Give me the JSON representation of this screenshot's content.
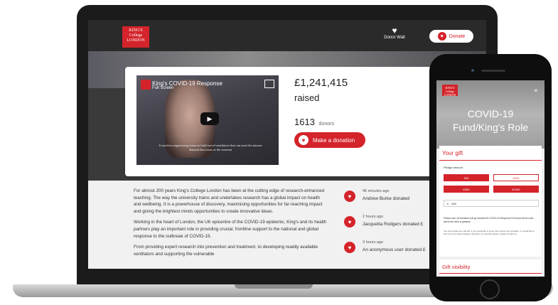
{
  "header": {
    "logo_text": "KING'S College LONDON",
    "donor_wall_label": "Donor Wall",
    "donate_label": "Donate"
  },
  "video": {
    "title": "King's COVID-19 Response",
    "subtitle": "Full Screen",
    "caption": "It involves engineering teams to build novel ventilators that can meet the intense demand that exists at the moment"
  },
  "campaign": {
    "raised_amount": "£1,241,415",
    "raised_label": "raised",
    "donor_count": "1613",
    "donors_word": "donors",
    "make_donation_label": "Make a donation"
  },
  "story": {
    "paragraphs": [
      "For almost 200 years King's College London has been at the cutting edge of research-enhanced teaching. The way the university trains and undertakes research has a global impact on health and wellbeing. It is a powerhouse of discovery, maximising opportunities for far-reaching impact and giving the brightest minds opportunities to create innovative ideas.",
      "Working in the heart of London, the UK epicentre of the COVID-19 epidemic, King's and its health partners play an important role in providing crucial, frontline support to the national and global response to the outbreak of COVID-19.",
      "From providing expert research into prevention and treatment, to developing readily available ventilators and supporting the vulnerable"
    ]
  },
  "recent_donations": [
    {
      "time": "46 minutes ago",
      "who": "Andrew Burke donated"
    },
    {
      "time": "2 hours ago",
      "who": "Jacquetta Rodgers donated £"
    },
    {
      "time": "3 hours ago",
      "who": "An anonymous user donated £"
    }
  ],
  "mobile": {
    "logo_text": "KING'S College LONDON",
    "title_line1": "COVID-19",
    "title_line2": "Fund/King's Role",
    "gift_title": "Your gift",
    "pledge_label": "Pledge amount",
    "amounts": [
      "£50",
      "£100",
      "£500",
      "£1000"
    ],
    "currency_symbol": "£",
    "other_amount": "500",
    "note": "Please note, all donations will go towards the COVID-19 Response Fund and will be used where the need is greatest.",
    "note_small": "You can donate as a gift aid. If you would like to know more about your donation, or would like to find out more about making a donation to a specific project, please contact us.",
    "visibility_title": "Gift visibility"
  },
  "colors": {
    "brand_red": "#d4232a",
    "header_dark": "#2a2a2a",
    "content_bg": "#f1f1f1"
  }
}
